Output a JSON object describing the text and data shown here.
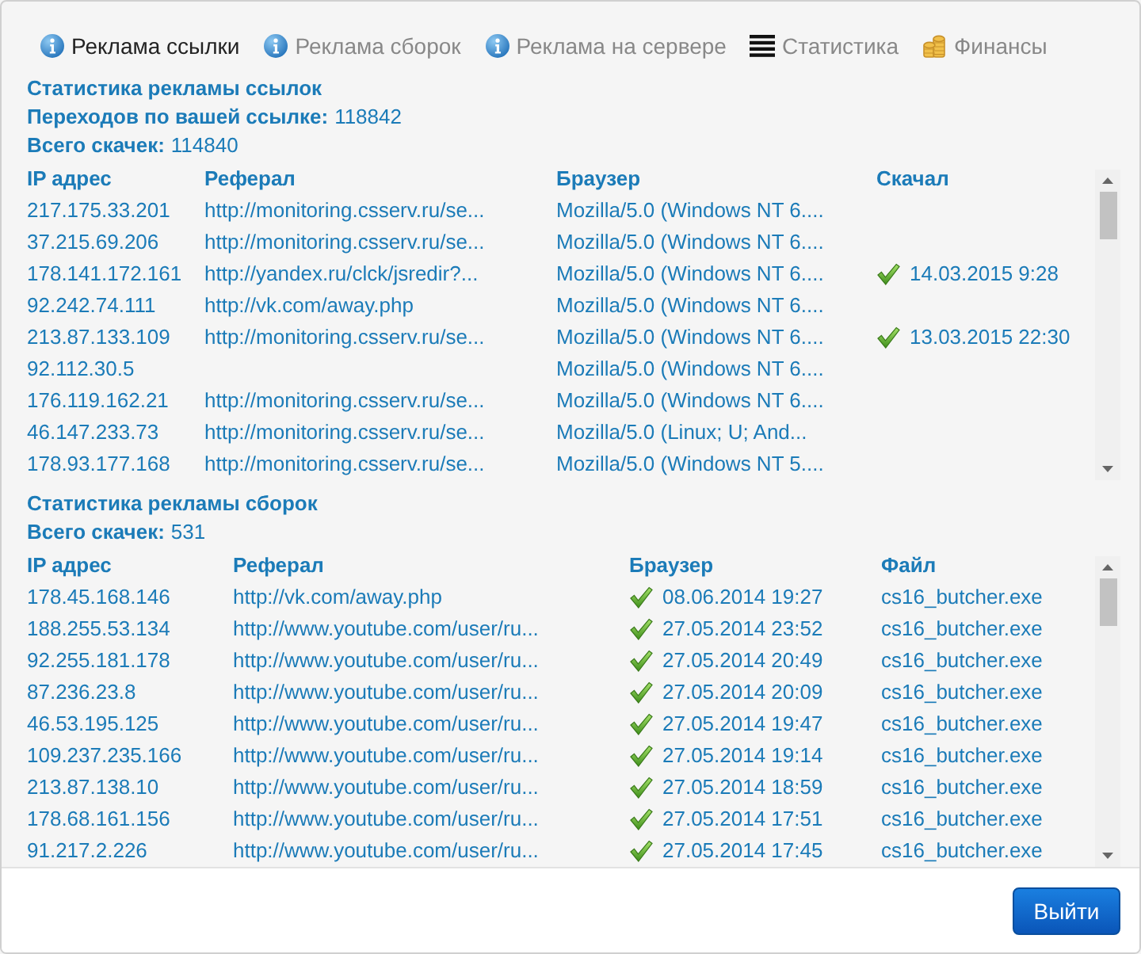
{
  "tabs": [
    {
      "label": "Реклама ссылки",
      "kind": "info",
      "selected": true
    },
    {
      "label": "Реклама сборок",
      "kind": "info",
      "selected": false
    },
    {
      "label": "Реклама на сервере",
      "kind": "info",
      "selected": false
    },
    {
      "label": "Статистика",
      "kind": "list",
      "selected": false
    },
    {
      "label": "Финансы",
      "kind": "coins",
      "selected": false
    }
  ],
  "sections": [
    {
      "title": "Статистика рекламы ссылок",
      "stats": [
        {
          "label": "Переходов по вашей ссылке:",
          "value": "118842"
        },
        {
          "label": "Всего скачек:",
          "value": "114840"
        }
      ],
      "table": {
        "columns": [
          "IP адрес",
          "Реферал",
          "Браузер",
          "Скачал"
        ],
        "rows": [
          [
            "217.175.33.201",
            "http://monitoring.csserv.ru/se...",
            "Mozilla/5.0 (Windows NT 6....",
            null
          ],
          [
            "37.215.69.206",
            "http://monitoring.csserv.ru/se...",
            "Mozilla/5.0 (Windows NT 6....",
            null
          ],
          [
            "178.141.172.161",
            "http://yandex.ru/clck/jsredir?...",
            "Mozilla/5.0 (Windows NT 6....",
            {
              "kind": "check",
              "text": "14.03.2015 9:28"
            }
          ],
          [
            "92.242.74.111",
            "http://vk.com/away.php",
            "Mozilla/5.0 (Windows NT 6....",
            null
          ],
          [
            "213.87.133.109",
            "http://monitoring.csserv.ru/se...",
            "Mozilla/5.0 (Windows NT 6....",
            {
              "kind": "check",
              "text": "13.03.2015 22:30"
            }
          ],
          [
            "92.112.30.5",
            null,
            "Mozilla/5.0 (Windows NT 6....",
            null
          ],
          [
            "176.119.162.21",
            "http://monitoring.csserv.ru/se...",
            "Mozilla/5.0 (Windows NT 6....",
            null
          ],
          [
            "46.147.233.73",
            "http://monitoring.csserv.ru/se...",
            "Mozilla/5.0 (Linux; U; And...",
            null
          ],
          [
            "178.93.177.168",
            "http://monitoring.csserv.ru/se...",
            "Mozilla/5.0 (Windows NT 5....",
            null
          ]
        ]
      }
    },
    {
      "title": "Статистика рекламы сборок",
      "stats": [
        {
          "label": "Всего скачек:",
          "value": "531"
        }
      ],
      "table": {
        "columns": [
          "IP адрес",
          "Реферал",
          "Браузер",
          "Файл"
        ],
        "rows": [
          [
            "178.45.168.146",
            "http://vk.com/away.php",
            {
              "kind": "check",
              "text": "08.06.2014 19:27"
            },
            "cs16_butcher.exe"
          ],
          [
            "188.255.53.134",
            "http://www.youtube.com/user/ru...",
            {
              "kind": "check",
              "text": "27.05.2014 23:52"
            },
            "cs16_butcher.exe"
          ],
          [
            "92.255.181.178",
            "http://www.youtube.com/user/ru...",
            {
              "kind": "check",
              "text": "27.05.2014 20:49"
            },
            "cs16_butcher.exe"
          ],
          [
            "87.236.23.8",
            "http://www.youtube.com/user/ru...",
            {
              "kind": "check",
              "text": "27.05.2014 20:09"
            },
            "cs16_butcher.exe"
          ],
          [
            "46.53.195.125",
            "http://www.youtube.com/user/ru...",
            {
              "kind": "check",
              "text": "27.05.2014 19:47"
            },
            "cs16_butcher.exe"
          ],
          [
            "109.237.235.166",
            "http://www.youtube.com/user/ru...",
            {
              "kind": "check",
              "text": "27.05.2014 19:14"
            },
            "cs16_butcher.exe"
          ],
          [
            "213.87.138.10",
            "http://www.youtube.com/user/ru...",
            {
              "kind": "check",
              "text": "27.05.2014 18:59"
            },
            "cs16_butcher.exe"
          ],
          [
            "178.68.161.156",
            "http://www.youtube.com/user/ru...",
            {
              "kind": "check",
              "text": "27.05.2014 17:51"
            },
            "cs16_butcher.exe"
          ],
          [
            "91.217.2.226",
            "http://www.youtube.com/user/ru...",
            {
              "kind": "check",
              "text": "27.05.2014 17:45"
            },
            "cs16_butcher.exe"
          ]
        ]
      }
    }
  ],
  "button": "Выйти"
}
